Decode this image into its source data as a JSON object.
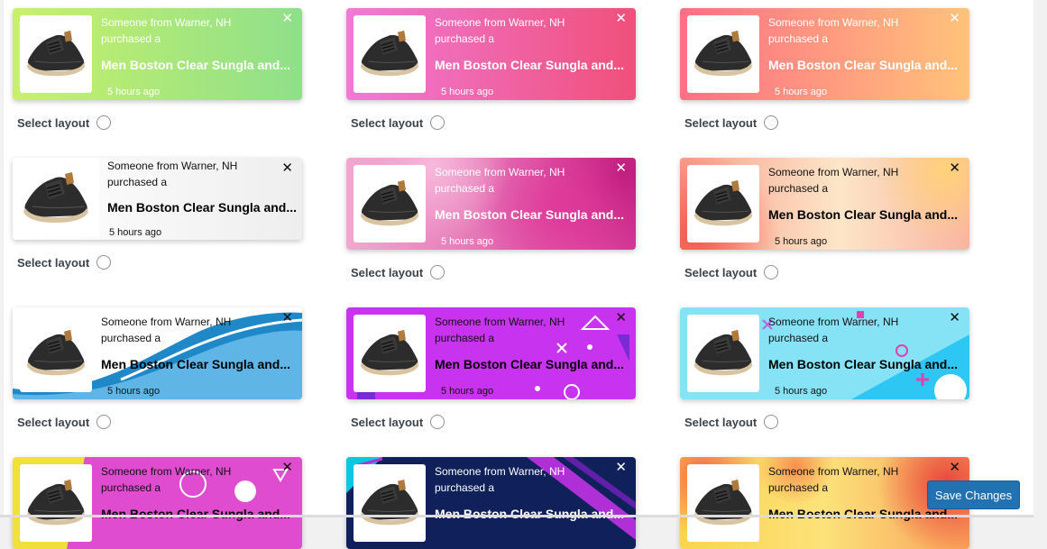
{
  "notification": {
    "line1": "Someone from Warner, NH",
    "line2": "purchased a",
    "product": "Men Boston Clear Sungla and...",
    "time": "5 hours ago",
    "close": "✕"
  },
  "select_label": "Select layout",
  "save_label": "Save Changes",
  "layouts": [
    {
      "theme": "green-gradient",
      "colors": [
        "#c9f06a",
        "#8fe08a"
      ]
    },
    {
      "theme": "pink-gradient",
      "colors": [
        "#f07ad8",
        "#f0507a"
      ]
    },
    {
      "theme": "orange-gradient",
      "colors": [
        "#ff6f86",
        "#ffc37a"
      ]
    },
    {
      "theme": "plain-light",
      "colors": [
        "#ffffff",
        "#eeeeee"
      ]
    },
    {
      "theme": "orchid-photo",
      "colors": [
        "#d63c9a",
        "#f7a6d2"
      ]
    },
    {
      "theme": "floral-pastel",
      "colors": [
        "#f56e62",
        "#fde0b8"
      ]
    },
    {
      "theme": "blue-waves",
      "colors": [
        "#ffffff",
        "#1e88c8"
      ]
    },
    {
      "theme": "purple-memphis",
      "colors": [
        "#c02cf0",
        "#e64cf6"
      ]
    },
    {
      "theme": "cyan-memphis",
      "colors": [
        "#7fe6f8",
        "#22c4f0"
      ]
    },
    {
      "theme": "yellow-pink-memphis",
      "colors": [
        "#f6e23c",
        "#e04cd0"
      ]
    },
    {
      "theme": "navy-diagonal",
      "colors": [
        "#10205a",
        "#0bc8e0"
      ]
    },
    {
      "theme": "summer-flowers",
      "colors": [
        "#fbd44e",
        "#f47a52"
      ]
    }
  ]
}
